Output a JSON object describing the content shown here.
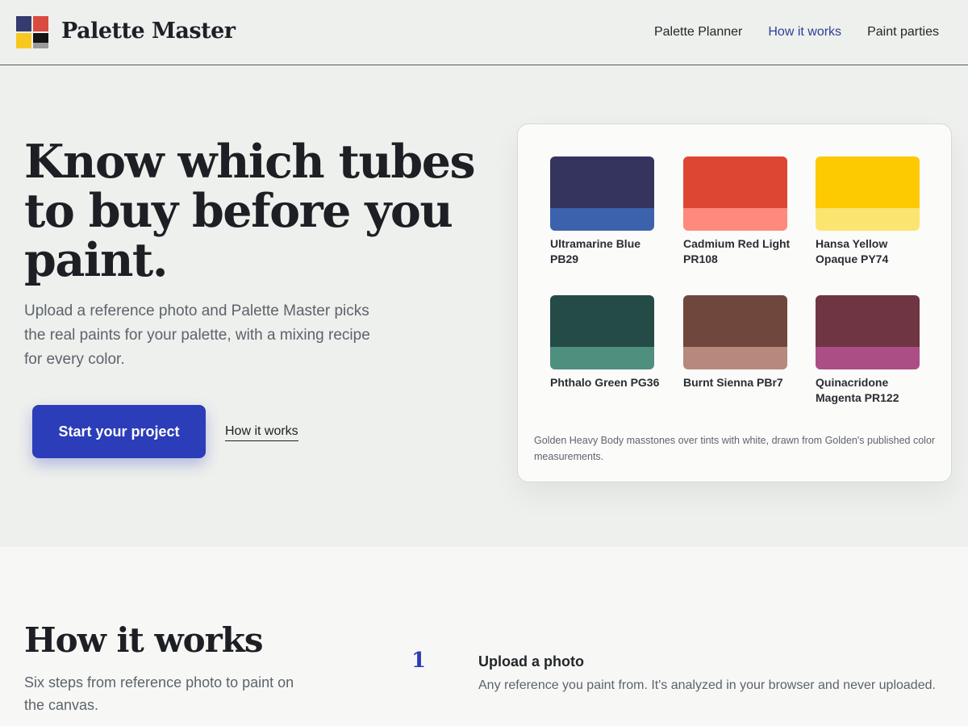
{
  "header": {
    "brand": "Palette Master",
    "logo_colors": [
      "#363b6e",
      "#d94b3e",
      "#f7c820",
      "#141414",
      "#9a9a9a"
    ],
    "nav": [
      {
        "label": "Palette Planner",
        "active": false
      },
      {
        "label": "How it works",
        "active": true
      },
      {
        "label": "Paint parties",
        "active": false
      }
    ]
  },
  "hero": {
    "title": "Know which tubes to buy before you paint.",
    "subtitle": "Upload a reference photo and Palette Master picks the real paints for your palette, with a mixing recipe for every color.",
    "cta_label": "Start your project",
    "secondary_link": "How it works"
  },
  "palette_card": {
    "swatches": [
      {
        "name": "Ultramarine Blue PB29",
        "masstone": "#35345f",
        "tint": "#3d62ad"
      },
      {
        "name": "Cadmium Red Light PR108",
        "masstone": "#de4634",
        "tint": "#fd8a7c"
      },
      {
        "name": "Hansa Yellow Opaque PY74",
        "masstone": "#fdc901",
        "tint": "#fce471"
      },
      {
        "name": "Phthalo Green PG36",
        "masstone": "#244b45",
        "tint": "#4e8f7e"
      },
      {
        "name": "Burnt Sienna PBr7",
        "masstone": "#6f473c",
        "tint": "#b7887c"
      },
      {
        "name": "Quinacridone Magenta PR122",
        "masstone": "#703543",
        "tint": "#ab4e85"
      }
    ],
    "note": "Golden Heavy Body masstones over tints with white, drawn from Golden's published color measurements."
  },
  "how_it_works": {
    "title": "How it works",
    "subtitle": "Six steps from reference photo to paint on the canvas.",
    "steps": [
      {
        "number": "1",
        "title": "Upload a photo",
        "text": "Any reference you paint from. It's analyzed in your browser and never uploaded."
      }
    ]
  },
  "colors": {
    "accent": "#2b3db8",
    "nav_active": "#2d3e9b",
    "page_bg": "#eef0ed",
    "section_bg": "#f7f8f6"
  }
}
